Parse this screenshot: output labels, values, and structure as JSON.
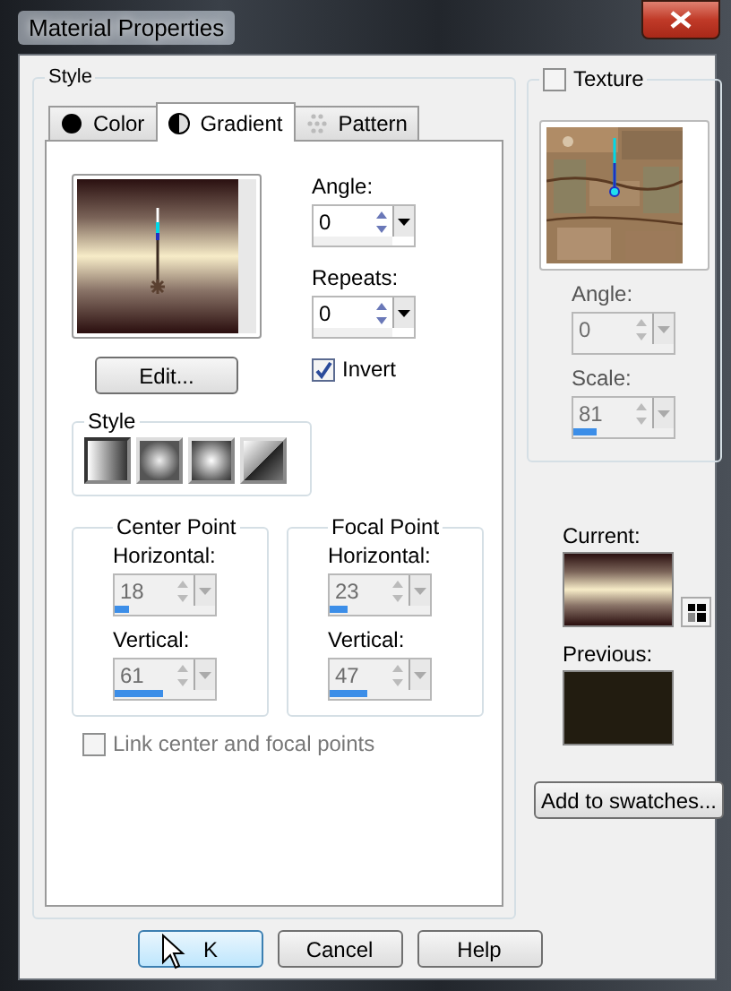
{
  "window": {
    "title": "Material Properties"
  },
  "style_group": {
    "label": "Style"
  },
  "tabs": [
    {
      "label": "Color",
      "kind": "color",
      "selected": false
    },
    {
      "label": "Gradient",
      "kind": "gradient",
      "selected": true
    },
    {
      "label": "Pattern",
      "kind": "pattern",
      "selected": false
    }
  ],
  "gradient": {
    "spins": [
      {
        "label": "Angle:",
        "value": "0",
        "disabled": false
      },
      {
        "label": "Repeats:",
        "value": "0",
        "disabled": false
      }
    ],
    "edit_button": "Edit...",
    "invert": {
      "label": "Invert",
      "checked": true
    },
    "style": {
      "label": "Style",
      "options": [
        {
          "kind": "linear",
          "selected": true
        },
        {
          "kind": "rectangular",
          "selected": false
        },
        {
          "kind": "radial",
          "selected": false
        },
        {
          "kind": "sunburst",
          "selected": false
        }
      ]
    }
  },
  "points": [
    {
      "label": "Center Point",
      "fields": [
        {
          "label": "Horizontal:",
          "value": "18",
          "level": 0.18,
          "disabled": true
        },
        {
          "label": "Vertical:",
          "value": "61",
          "level": 0.61,
          "disabled": true
        }
      ]
    },
    {
      "label": "Focal Point",
      "fields": [
        {
          "label": "Horizontal:",
          "value": "23",
          "level": 0.23,
          "disabled": true
        },
        {
          "label": "Vertical:",
          "value": "47",
          "level": 0.47,
          "disabled": true
        }
      ]
    }
  ],
  "link": {
    "label": "Link center and focal points",
    "checked": false,
    "disabled": true
  },
  "texture": {
    "label": "Texture",
    "checked": false,
    "fields": [
      {
        "label": "Angle:",
        "value": "0",
        "disabled": true
      },
      {
        "label": "Scale:",
        "value": "81",
        "level": 0.3,
        "disabled": true
      }
    ]
  },
  "current": {
    "label": "Current:"
  },
  "previous": {
    "label": "Previous:"
  },
  "add_button": "Add to swatches...",
  "buttons": [
    {
      "label": "K",
      "kind": "ok"
    },
    {
      "label": "Cancel",
      "kind": "cancel"
    },
    {
      "label": "Help",
      "kind": "help"
    }
  ]
}
